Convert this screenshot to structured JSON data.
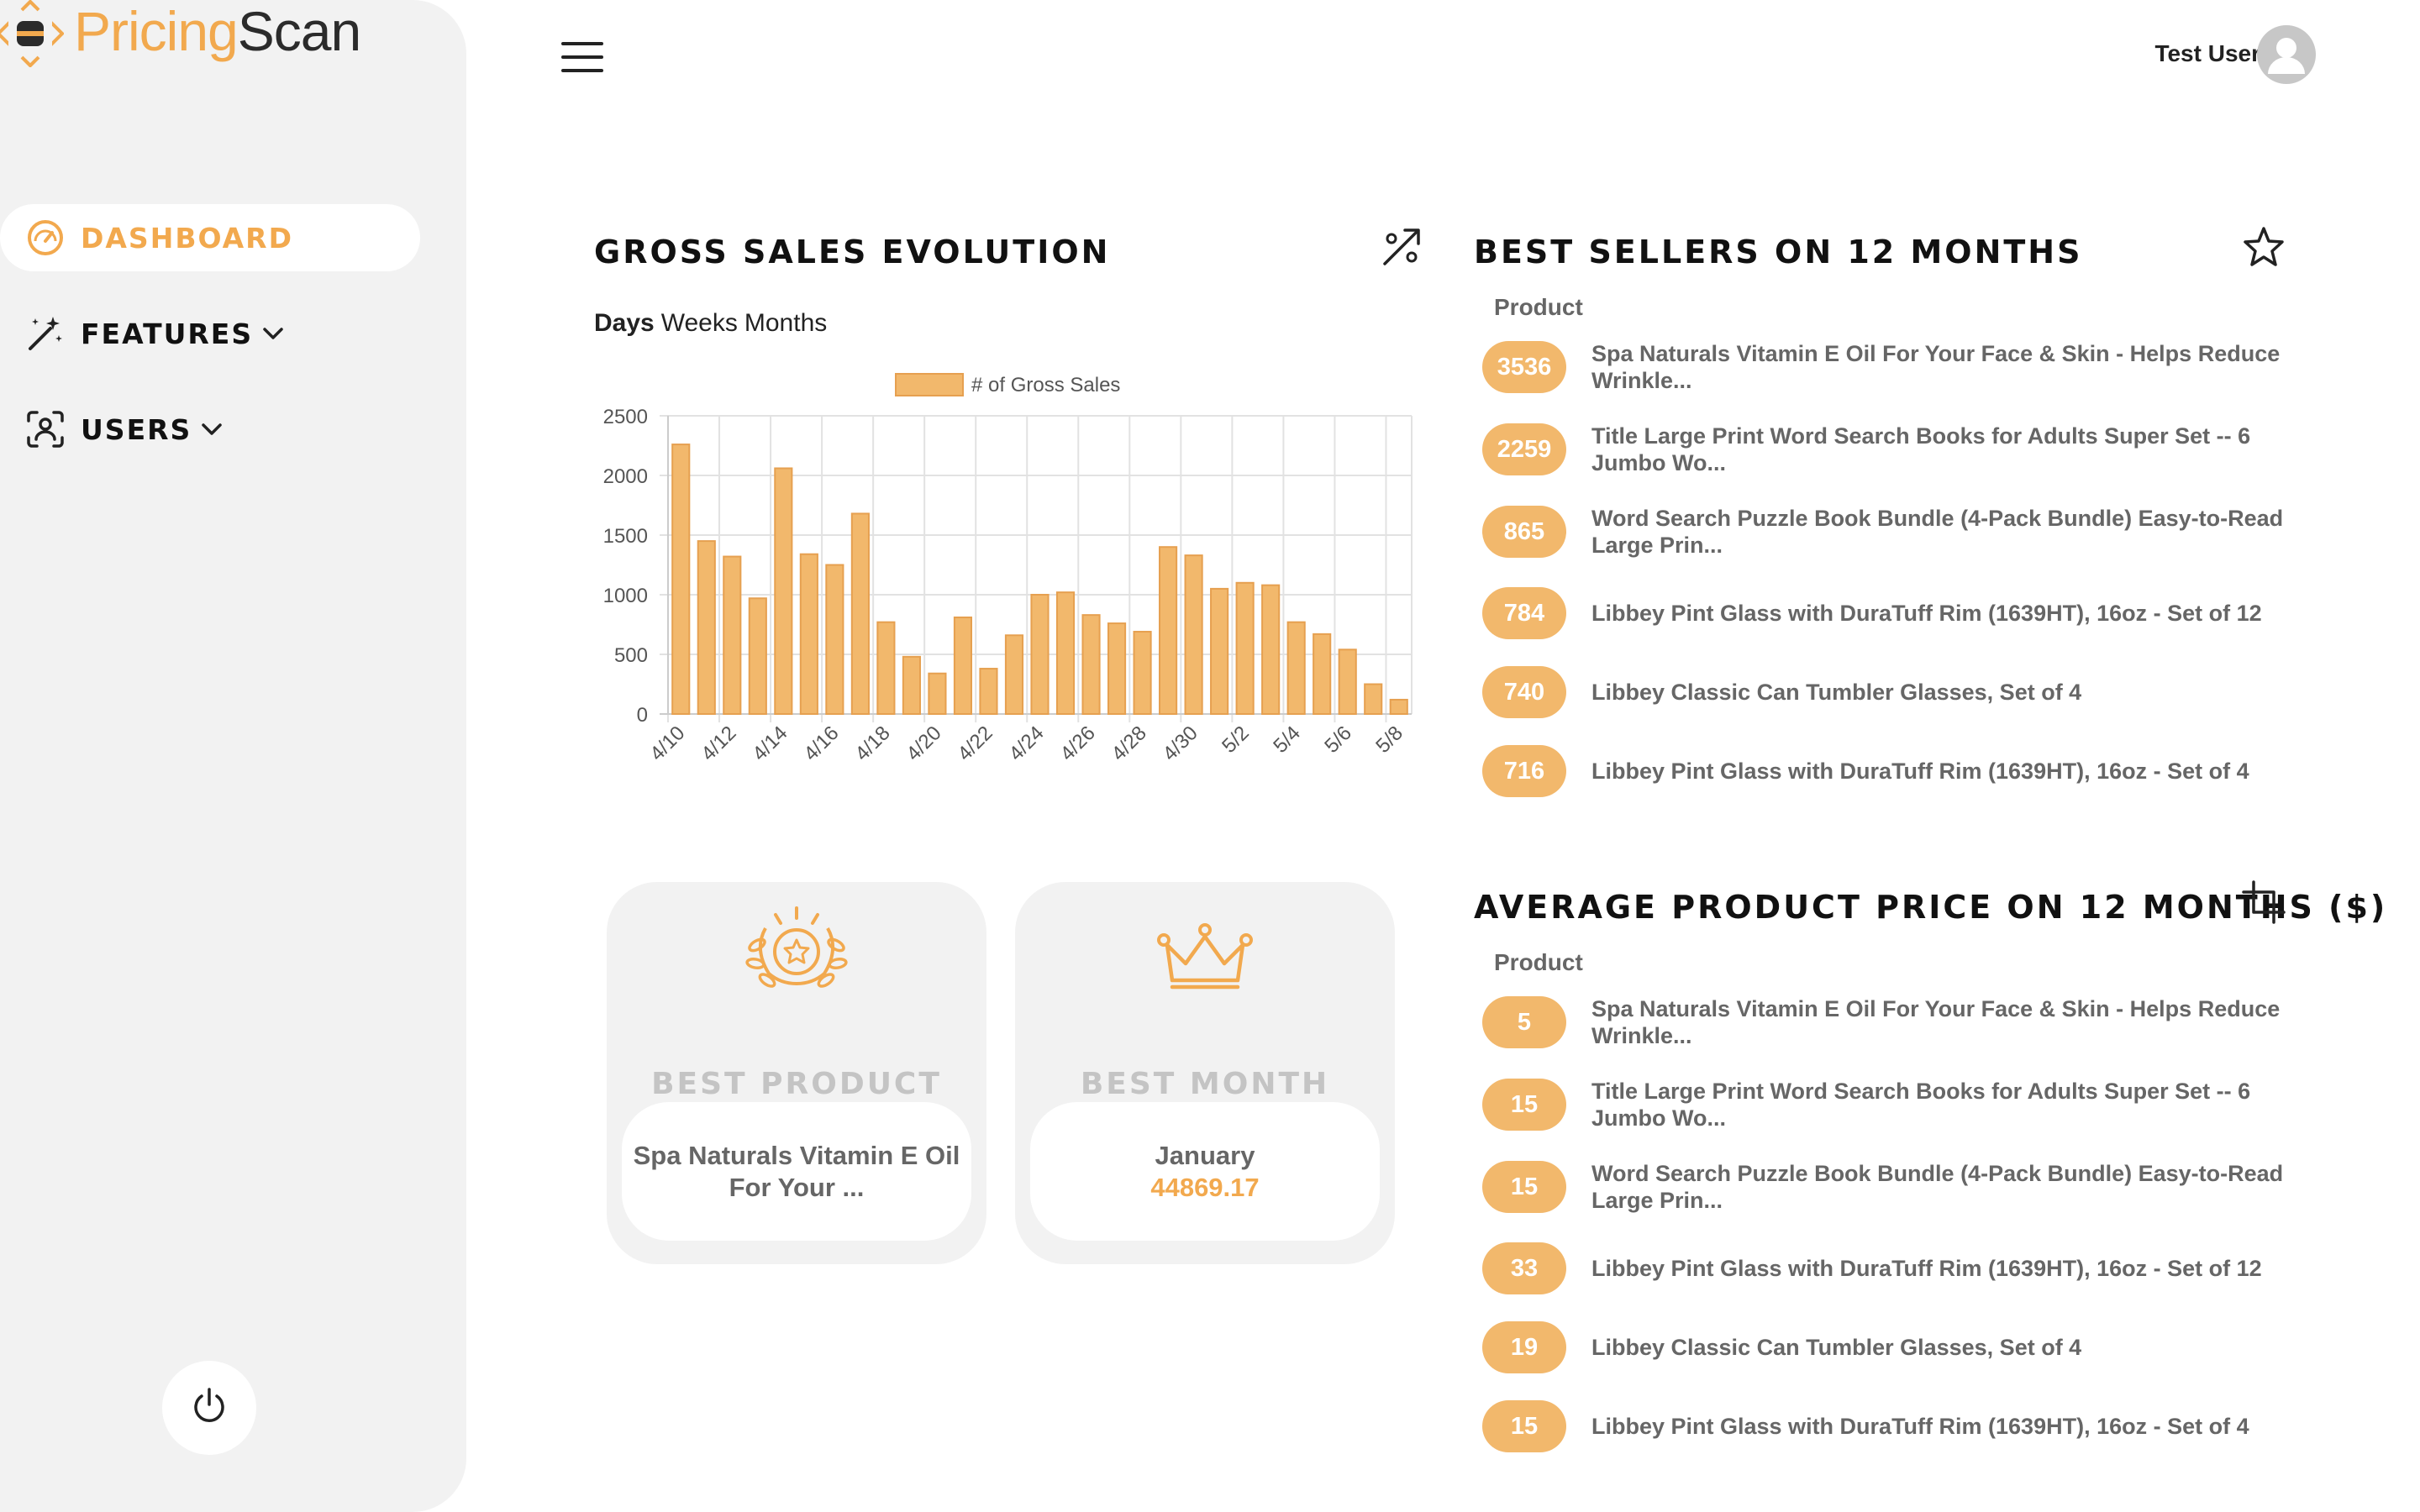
{
  "app": {
    "logo_part1": "Pricing",
    "logo_part2": "Scan"
  },
  "sidebar": {
    "items": [
      {
        "label": "DASHBOARD",
        "icon": "speedometer-icon",
        "active": true
      },
      {
        "label": "FEATURES",
        "icon": "magic-wand-icon",
        "active": false
      },
      {
        "label": "USERS",
        "icon": "face-scan-icon",
        "active": false
      }
    ],
    "logout_icon": "power-icon"
  },
  "topbar": {
    "user_name": "Test User",
    "menu_icon": "hamburger-icon",
    "avatar_icon": "user-avatar-icon"
  },
  "gross_sales": {
    "title": "GROSS SALES EVOLUTION",
    "icon": "trend-percent-icon",
    "tabs": [
      "Days",
      "Weeks",
      "Months"
    ],
    "active_tab": "Days"
  },
  "chart_data": {
    "type": "bar",
    "legend": "# of Gross Sales",
    "legend_position": "top",
    "grid": true,
    "ylim": [
      0,
      2500
    ],
    "yticks": [
      0,
      500,
      1000,
      1500,
      2000,
      2500
    ],
    "categories": [
      "4/10",
      "4/11",
      "4/12",
      "4/13",
      "4/14",
      "4/15",
      "4/16",
      "4/17",
      "4/18",
      "4/19",
      "4/20",
      "4/21",
      "4/22",
      "4/23",
      "4/24",
      "4/25",
      "4/26",
      "4/27",
      "4/28",
      "4/29",
      "4/30",
      "5/1",
      "5/2",
      "5/3",
      "5/4",
      "5/5",
      "5/6",
      "5/7",
      "5/8"
    ],
    "tick_labels": [
      "4/10",
      "4/12",
      "4/14",
      "4/16",
      "4/18",
      "4/20",
      "4/22",
      "4/24",
      "4/26",
      "4/28",
      "4/30",
      "5/2",
      "5/4",
      "5/6",
      "5/8"
    ],
    "values": [
      2260,
      1450,
      1320,
      970,
      2060,
      1340,
      1250,
      1680,
      770,
      480,
      340,
      810,
      380,
      660,
      1000,
      1020,
      830,
      760,
      690,
      1400,
      1330,
      1050,
      1100,
      1080,
      770,
      670,
      540,
      250,
      120
    ],
    "color": "#f2b86c",
    "border_color": "#e6a050"
  },
  "cards": {
    "best_product": {
      "title": "BEST PRODUCT",
      "value": "Spa Naturals Vitamin E Oil For Your ...",
      "icon": "laurel-star-icon"
    },
    "best_month": {
      "title": "BEST MONTH",
      "month": "January",
      "value": "44869.17",
      "icon": "crown-icon"
    }
  },
  "best_sellers": {
    "title": "BEST SELLERS ON 12 MONTHS",
    "icon": "star-outline-icon",
    "column_header": "Product",
    "rows": [
      {
        "count": "3536",
        "product": "Spa Naturals Vitamin E Oil For Your Face & Skin - Helps Reduce Wrinkle..."
      },
      {
        "count": "2259",
        "product": "Title Large Print Word Search Books for Adults Super Set -- 6 Jumbo Wo..."
      },
      {
        "count": "865",
        "product": "Word Search Puzzle Book Bundle (4-Pack Bundle) Easy-to-Read Large Prin..."
      },
      {
        "count": "784",
        "product": "Libbey Pint Glass with DuraTuff Rim (1639HT), 16oz - Set of 12"
      },
      {
        "count": "740",
        "product": "Libbey Classic Can Tumbler Glasses, Set of 4"
      },
      {
        "count": "716",
        "product": "Libbey Pint Glass with DuraTuff Rim (1639HT), 16oz - Set of 4"
      }
    ]
  },
  "avg_price": {
    "title": "AVERAGE PRODUCT PRICE ON 12 MONTHS ($)",
    "icon": "crop-icon",
    "column_header": "Product",
    "rows": [
      {
        "count": "5",
        "product": "Spa Naturals Vitamin E Oil For Your Face & Skin - Helps Reduce Wrinkle..."
      },
      {
        "count": "15",
        "product": "Title Large Print Word Search Books for Adults Super Set -- 6 Jumbo Wo..."
      },
      {
        "count": "15",
        "product": "Word Search Puzzle Book Bundle (4-Pack Bundle) Easy-to-Read Large Prin..."
      },
      {
        "count": "33",
        "product": "Libbey Pint Glass with DuraTuff Rim (1639HT), 16oz - Set of 12"
      },
      {
        "count": "19",
        "product": "Libbey Classic Can Tumbler Glasses, Set of 4"
      },
      {
        "count": "15",
        "product": "Libbey Pint Glass with DuraTuff Rim (1639HT), 16oz - Set of 4"
      }
    ]
  },
  "colors": {
    "accent": "#f2a94e",
    "badge": "#f2b86c",
    "panel": "#f2f2f2"
  }
}
